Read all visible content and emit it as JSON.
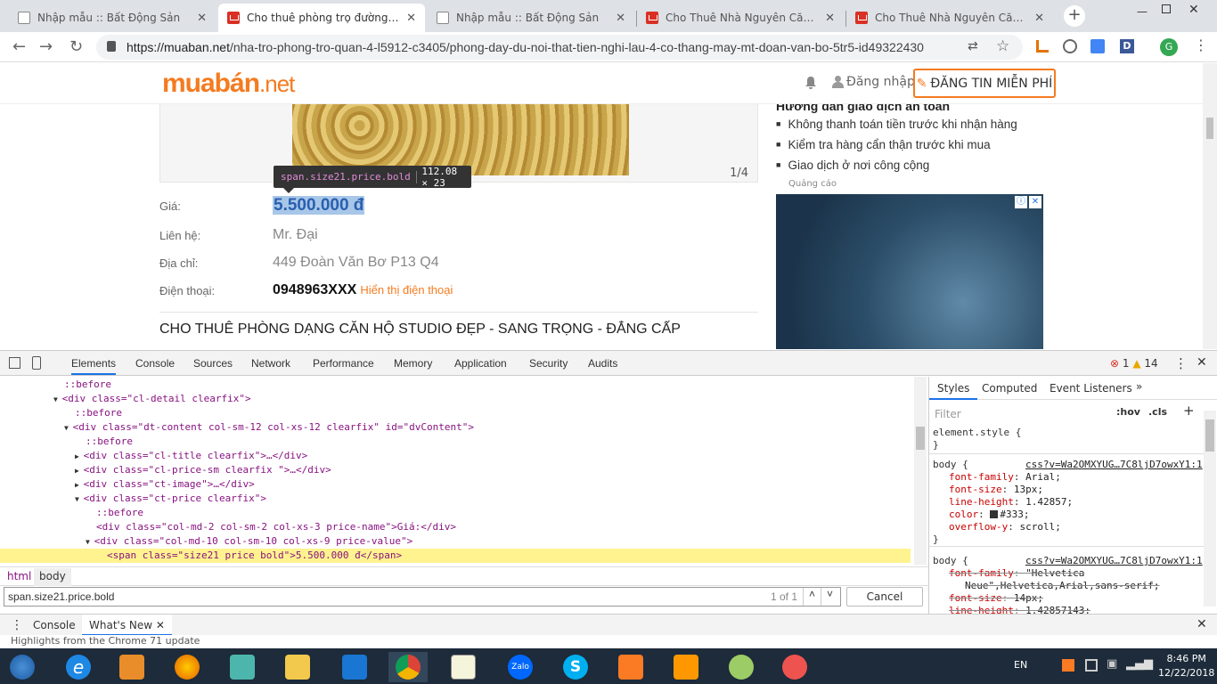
{
  "browser": {
    "tabs": [
      {
        "title": "Nhập mẫu :: Bất Động Sản",
        "favicon": "doc-icon"
      },
      {
        "title": "Cho thuê phòng trọ đường Đoàn V",
        "favicon": "muaban-icon",
        "active": true
      },
      {
        "title": "Nhập mẫu :: Bất Động Sản",
        "favicon": "doc-icon"
      },
      {
        "title": "Cho Thuê Nhà Nguyên Căn, Bất Độ",
        "favicon": "muaban-icon"
      },
      {
        "title": "Cho Thuê Nhà Nguyên Căn, Bất Độ",
        "favicon": "muaban-icon"
      }
    ],
    "url_host": "https://muaban.net",
    "url_path": "/nha-tro-phong-tro-quan-4-l5912-c3405/phong-day-du-noi-that-tien-nghi-lau-4-co-thang-may-mt-doan-van-bo-5tr5-id49322430",
    "profile_initial": "G",
    "ext_d": "D"
  },
  "site": {
    "logo_main": "muabán",
    "logo_tld": ".net",
    "login": "Đăng nhập",
    "post_button": "ĐĂNG TIN MIỄN PHÍ"
  },
  "listing": {
    "image_counter": "1/4",
    "price_label": "Giá:",
    "price": "5.500.000 đ",
    "contact_label": "Liên hệ:",
    "contact": "Mr. Đại",
    "address_label": "Địa chỉ:",
    "address": "449 Đoàn Văn Bơ P13 Q4",
    "phone_label": "Điện thoại:",
    "phone": "0948963XXX",
    "show_phone": "Hiển thị điện thoại",
    "title": "CHO THUÊ PHÒNG DẠNG CĂN HỘ STUDIO ĐẸP - SANG TRỌNG - ĐẲNG CẤP"
  },
  "sidebar": {
    "guide_title": "Hướng dẫn giao dịch an toàn",
    "tips": [
      "Không thanh toán tiền trước khi nhận hàng",
      "Kiểm tra hàng cẩn thận trước khi mua",
      "Giao dịch ở nơi công cộng"
    ],
    "ad_label": "Quảng cáo"
  },
  "inspector_tooltip": {
    "selector": "span.size21.price.bold",
    "size": "112.08 × 23"
  },
  "devtools": {
    "tabs": [
      "Elements",
      "Console",
      "Sources",
      "Network",
      "Performance",
      "Memory",
      "Application",
      "Security",
      "Audits"
    ],
    "error_count": "1",
    "warning_count": "14",
    "crumbs": [
      "html",
      "body"
    ],
    "search_value": "span.size21.price.bold",
    "search_result": "1 of 1",
    "cancel": "Cancel",
    "styles_tabs": [
      "Styles",
      "Computed",
      "Event Listeners"
    ],
    "filter_placeholder": "Filter",
    "hov": ":hov",
    "cls": ".cls",
    "element_style": "element.style {",
    "rule1_selector": "body {",
    "rule1_source": "css?v=Wa2OMXYUG…7C8ljD7owxY1:1",
    "rule1_props": [
      {
        "name": "font-family",
        "value": "Arial;"
      },
      {
        "name": "font-size",
        "value": "13px;"
      },
      {
        "name": "line-height",
        "value": "1.42857;"
      },
      {
        "name": "color",
        "value": "#333;"
      },
      {
        "name": "overflow-y",
        "value": "scroll;"
      }
    ],
    "rule2_selector": "body {",
    "rule2_source": "css?v=Wa2OMXYUG…7C8ljD7owxY1:1",
    "rule2_props": [
      {
        "name": "font-family",
        "value": "\"Helvetica"
      },
      {
        "name": "",
        "value": "Neue\",Helvetica,Arial,sans-serif;"
      },
      {
        "name": "font-size",
        "value": "14px;"
      },
      {
        "name": "line-height",
        "value": "1.42857143;"
      }
    ],
    "drawer_tabs": [
      "Console",
      "What's New"
    ],
    "drawer_status": "Highlights from the Chrome 71 update"
  },
  "dom_lines": [
    {
      "indent": 6,
      "text": "::before",
      "kind": "pseudo"
    },
    {
      "indent": 5,
      "arrow": "▼",
      "html": "<div class=\"cl-detail clearfix\">"
    },
    {
      "indent": 7,
      "text": "::before",
      "kind": "pseudo"
    },
    {
      "indent": 6,
      "arrow": "▼",
      "html": "<div class=\"dt-content col-sm-12 col-xs-12 clearfix\" id=\"dvContent\">"
    },
    {
      "indent": 8,
      "text": "::before",
      "kind": "pseudo"
    },
    {
      "indent": 7,
      "arrow": "▶",
      "html": "<div class=\"cl-title clearfix\">…</div>"
    },
    {
      "indent": 7,
      "arrow": "▶",
      "html": "<div class=\"cl-price-sm clearfix \">…</div>"
    },
    {
      "indent": 7,
      "arrow": "▶",
      "html": "<div class=\"ct-image\">…</div>"
    },
    {
      "indent": 7,
      "arrow": "▼",
      "html": "<div class=\"ct-price clearfix\">"
    },
    {
      "indent": 9,
      "text": "::before",
      "kind": "pseudo"
    },
    {
      "indent": 9,
      "html": "<div class=\"col-md-2 col-sm-2 col-xs-3 price-name\">Giá:</div>"
    },
    {
      "indent": 8,
      "arrow": "▼",
      "html": "<div class=\"col-md-10 col-sm-10 col-xs-9 price-value\">"
    },
    {
      "indent": 10,
      "html": "<span class=\"size21 price bold\">5.500.000 đ</span>",
      "highlight": true
    }
  ],
  "taskbar": {
    "lang": "EN",
    "time": "8:46 PM",
    "date": "12/22/2018",
    "apps": [
      "ie-icon",
      "media-icon",
      "firefox-icon",
      "notepad-icon",
      "explorer-icon",
      "vscode-icon",
      "chrome-icon",
      "terminal-icon",
      "zalo-icon",
      "skype-icon",
      "xampp-icon",
      "sublime-icon",
      "paint-icon",
      "snipping-icon"
    ],
    "zalo_label": "Zalo",
    "skype_label": "S"
  },
  "colors": {
    "brand": "#f47b20",
    "accent": "#1a73e8",
    "selection": "#fff38f"
  }
}
